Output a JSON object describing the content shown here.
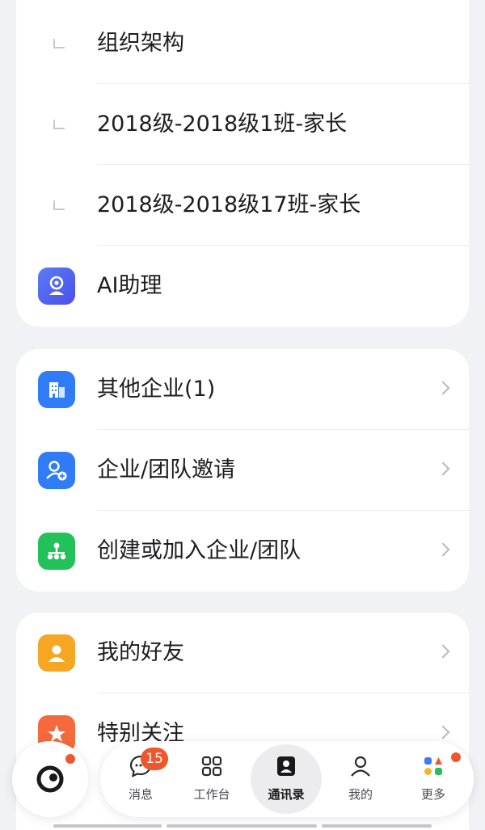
{
  "org_card": {
    "items": [
      {
        "label": "组织架构"
      },
      {
        "label": "2018级-2018级1班-家长"
      },
      {
        "label": "2018级-2018级17班-家长"
      }
    ],
    "ai_assistant": {
      "label": "AI助理",
      "icon": "ai-assistant-icon",
      "color": "#4f6bf5"
    }
  },
  "enterprise_card": {
    "items": [
      {
        "label": "其他企业(1)",
        "icon": "building-icon",
        "color": "#2f7cf6"
      },
      {
        "label": "企业/团队邀请",
        "icon": "user-invite-icon",
        "color": "#2f7cf6"
      },
      {
        "label": "创建或加入企业/团队",
        "icon": "org-chart-icon",
        "color": "#23c15a"
      }
    ]
  },
  "friends_card": {
    "items": [
      {
        "label": "我的好友",
        "icon": "person-icon",
        "color": "#f5a623"
      },
      {
        "label": "特别关注",
        "icon": "star-icon",
        "color": "#f56a3d"
      }
    ]
  },
  "tabbar": {
    "tabs": [
      {
        "label": "消息",
        "icon": "message-icon",
        "badge": "15"
      },
      {
        "label": "工作台",
        "icon": "grid-icon"
      },
      {
        "label": "通讯录",
        "icon": "contacts-icon",
        "active": true
      },
      {
        "label": "我的",
        "icon": "profile-icon"
      },
      {
        "label": "更多",
        "icon": "more-apps-icon"
      }
    ]
  },
  "colors": {
    "accent": "#f0562e",
    "background": "#f1f2f5"
  }
}
